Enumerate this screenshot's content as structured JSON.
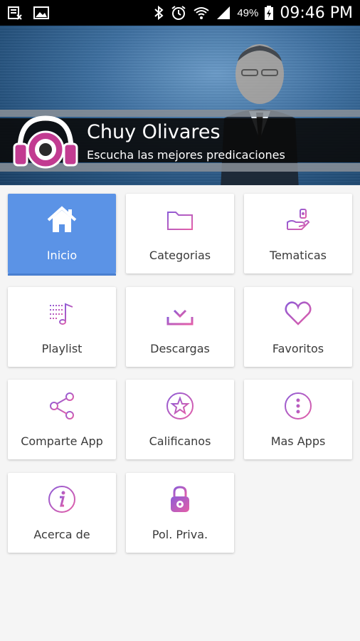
{
  "status_bar": {
    "battery_percent": "49%",
    "time": "09:46 PM",
    "icons": [
      "keyboard-x-icon",
      "gallery-icon",
      "bluetooth-icon",
      "alarm-icon",
      "wifi-icon",
      "signal-icon",
      "battery-charging-icon"
    ]
  },
  "header": {
    "title": "Chuy Olivares",
    "subtitle": "Escucha las mejores predicaciones"
  },
  "menu": [
    {
      "label": "Inicio",
      "icon": "home-icon",
      "active": true
    },
    {
      "label": "Categorias",
      "icon": "folder-icon"
    },
    {
      "label": "Tematicas",
      "icon": "hand-topics-icon"
    },
    {
      "label": "Playlist",
      "icon": "playlist-icon"
    },
    {
      "label": "Descargas",
      "icon": "download-icon"
    },
    {
      "label": "Favoritos",
      "icon": "heart-icon"
    },
    {
      "label": "Comparte App",
      "icon": "share-icon"
    },
    {
      "label": "Calificanos",
      "icon": "star-icon"
    },
    {
      "label": "Mas Apps",
      "icon": "more-vertical-icon"
    },
    {
      "label": "Acerca de",
      "icon": "info-icon"
    },
    {
      "label": "Pol. Priva.",
      "icon": "privacy-lock-icon"
    }
  ],
  "colors": {
    "accent_gradient_start": "#8e5bd6",
    "accent_gradient_end": "#e45fa8",
    "active_tile": "#5b93e6"
  }
}
